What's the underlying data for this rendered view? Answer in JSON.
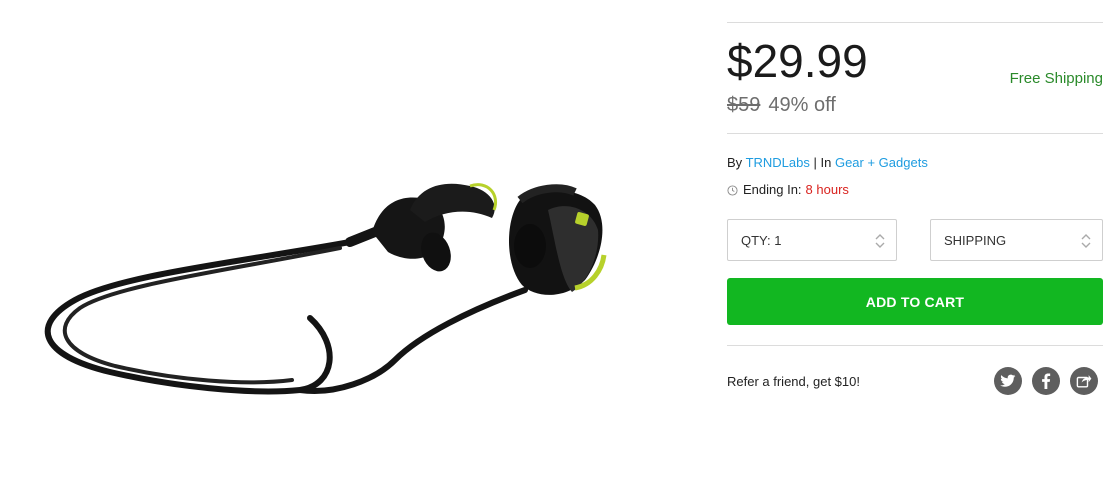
{
  "product": {
    "image_alt": "Bluetooth sport earbuds",
    "price": "$29.99",
    "was_price": "$59",
    "discount": "49% off",
    "free_shipping": "Free Shipping"
  },
  "meta": {
    "by_label": "By",
    "brand": "TRNDLabs",
    "separator": "|",
    "in_label": "In",
    "category": "Gear + Gadgets",
    "ending_label": "Ending In:",
    "ending_value": "8 hours"
  },
  "options": {
    "qty_label": "QTY: 1",
    "shipping_label": "SHIPPING"
  },
  "actions": {
    "add_to_cart": "ADD TO CART",
    "refer": "Refer a friend, get $10!"
  },
  "social": {
    "icons": [
      "twitter-icon",
      "facebook-icon",
      "share-icon"
    ],
    "color": "#5e5e5e"
  },
  "colors": {
    "accent_green": "#12b721",
    "link_blue": "#1e9ce0",
    "ending_red": "#d9231f",
    "free_shipping_green": "#2a8a2a"
  }
}
